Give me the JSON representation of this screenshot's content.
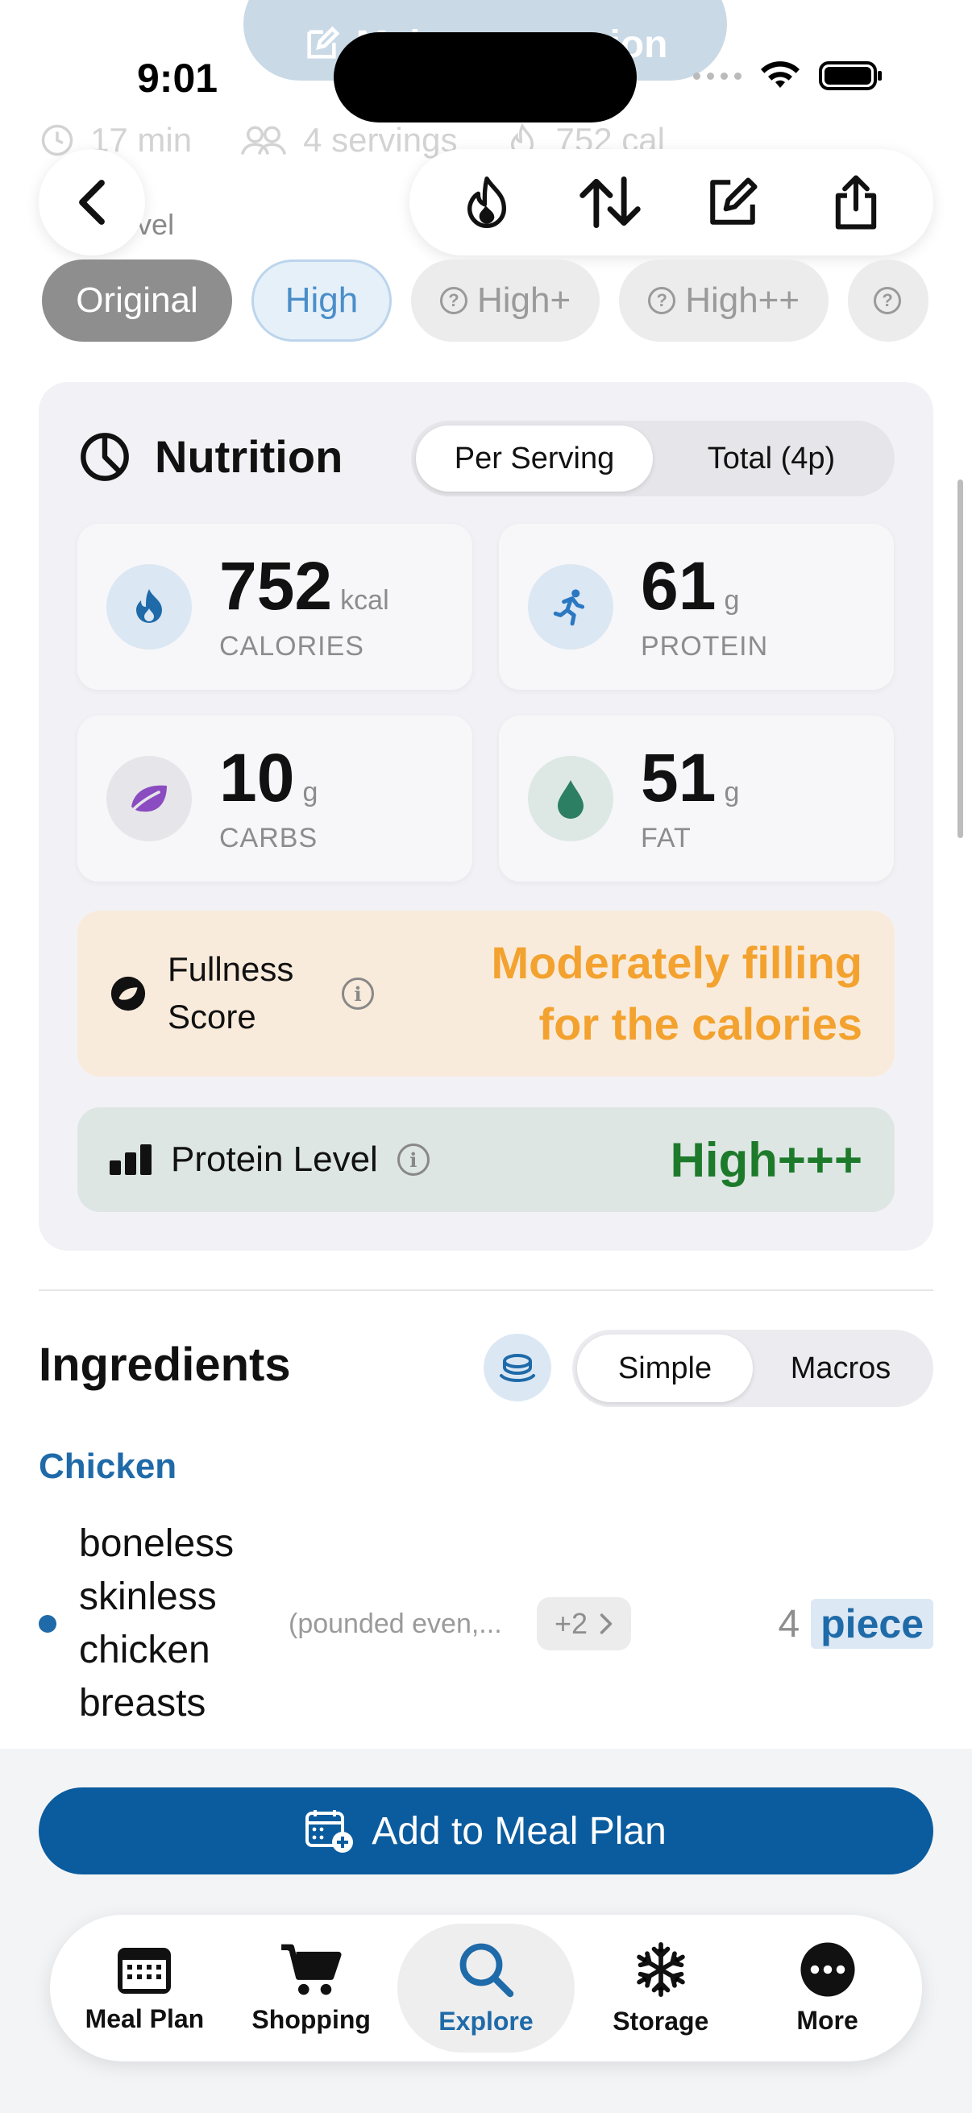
{
  "status": {
    "time": "9:01"
  },
  "ghost": {
    "make_version": "Make my version",
    "time": "17 min",
    "servings": "4 servings",
    "calories": "752 cal",
    "level_label": "Level"
  },
  "protein_levels": [
    {
      "label": "Original",
      "state": "selected"
    },
    {
      "label": "High",
      "state": "available"
    },
    {
      "label": "High+",
      "state": "locked"
    },
    {
      "label": "High++",
      "state": "locked"
    }
  ],
  "nutrition": {
    "title": "Nutrition",
    "toggle": {
      "per_serving": "Per Serving",
      "total": "Total (4p)"
    },
    "stats": {
      "calories": {
        "value": "752",
        "unit": "kcal",
        "label": "CALORIES"
      },
      "protein": {
        "value": "61",
        "unit": "g",
        "label": "PROTEIN"
      },
      "carbs": {
        "value": "10",
        "unit": "g",
        "label": "CARBS"
      },
      "fat": {
        "value": "51",
        "unit": "g",
        "label": "FAT"
      }
    },
    "fullness": {
      "label": "Fullness Score",
      "verdict": "Moderately filling for the calories"
    },
    "protein_level": {
      "label": "Protein Level",
      "value": "High+++"
    }
  },
  "ingredients": {
    "title": "Ingredients",
    "toggle": {
      "simple": "Simple",
      "macros": "Macros"
    },
    "groups": [
      {
        "name": "Chicken",
        "items": [
          {
            "name": "boneless skinless chicken breasts",
            "note": "(pounded even,...",
            "more": "+2",
            "qty": "4",
            "unit": "piece"
          }
        ]
      }
    ]
  },
  "actions": {
    "add_to_meal_plan": "Add to Meal Plan"
  },
  "tabbar": [
    {
      "label": "Meal Plan",
      "icon": "calendar-icon"
    },
    {
      "label": "Shopping",
      "icon": "cart-icon"
    },
    {
      "label": "Explore",
      "icon": "search-icon",
      "active": true
    },
    {
      "label": "Storage",
      "icon": "snowflake-icon"
    },
    {
      "label": "More",
      "icon": "more-icon"
    }
  ],
  "colors": {
    "accent": "#1f6aa8",
    "primary_button": "#0b5c9e",
    "fullness_bg": "#f9ebdb",
    "fullness_text": "#f3a22f",
    "protein_level_text": "#1d7a2b"
  }
}
